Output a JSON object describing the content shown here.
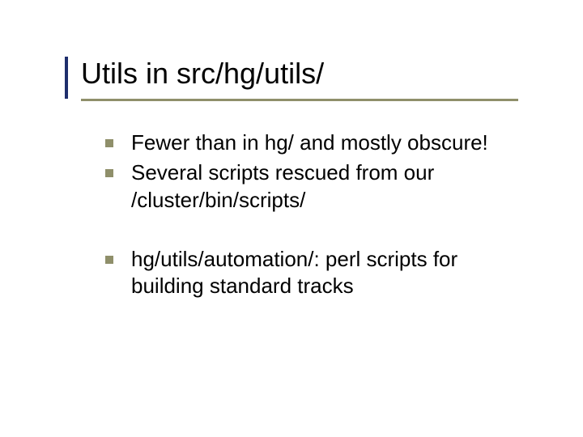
{
  "title": "Utils in src/hg/utils/",
  "bullets_group1": [
    "Fewer than in hg/ and mostly obscure!",
    "Several scripts rescued from our /cluster/bin/scripts/"
  ],
  "bullets_group2": [
    "hg/utils/automation/: perl scripts for building standard tracks"
  ]
}
